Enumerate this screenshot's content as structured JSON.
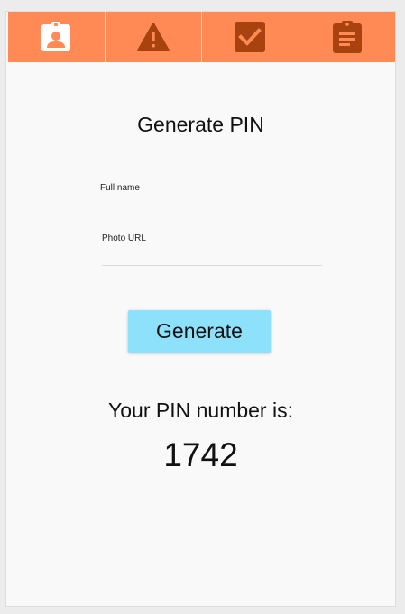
{
  "tabs": [
    {
      "name": "badge",
      "icon": "id-badge-icon"
    },
    {
      "name": "warning",
      "icon": "warning-icon"
    },
    {
      "name": "check",
      "icon": "checkbox-icon"
    },
    {
      "name": "clipboard",
      "icon": "clipboard-icon"
    }
  ],
  "form": {
    "title": "Generate PIN",
    "full_name_label": "Full name",
    "full_name_value": "",
    "photo_url_label": "Photo URL",
    "photo_url_value": "",
    "generate_label": "Generate"
  },
  "result": {
    "label": "Your PIN number is:",
    "pin": "1742"
  },
  "colors": {
    "tabbar": "#ff8a56",
    "icon_light": "#ffffff",
    "icon_dark": "#a8420f",
    "button": "#8ee1fb",
    "background": "#f9f9f9"
  }
}
